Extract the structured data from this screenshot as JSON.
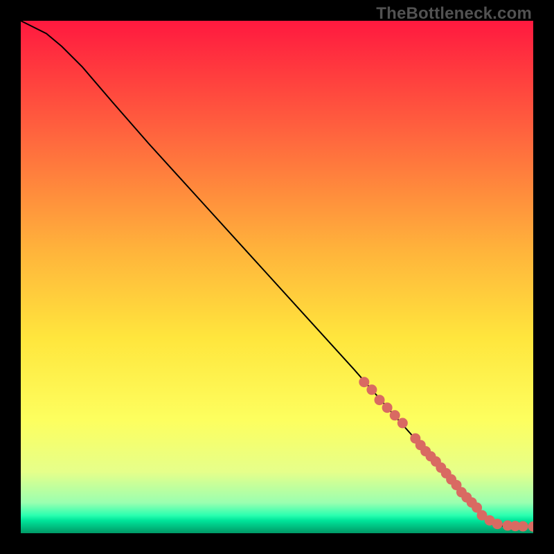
{
  "watermark": "TheBottleneck.com",
  "colors": {
    "gradient_stops": [
      {
        "offset": 0.0,
        "color": "#ff193f"
      },
      {
        "offset": 0.2,
        "color": "#ff5d3e"
      },
      {
        "offset": 0.45,
        "color": "#ffb43b"
      },
      {
        "offset": 0.62,
        "color": "#ffe63d"
      },
      {
        "offset": 0.78,
        "color": "#fdff5f"
      },
      {
        "offset": 0.88,
        "color": "#e6ff8a"
      },
      {
        "offset": 0.94,
        "color": "#9bffb0"
      },
      {
        "offset": 0.965,
        "color": "#2bffb0"
      },
      {
        "offset": 0.975,
        "color": "#00e59a"
      },
      {
        "offset": 1.0,
        "color": "#009966"
      }
    ],
    "curve": "#000000",
    "marker_fill": "#d96a62",
    "marker_stroke": "#d96a62"
  },
  "chart_data": {
    "type": "line",
    "title": "",
    "xlabel": "",
    "ylabel": "",
    "xlim": [
      0,
      100
    ],
    "ylim": [
      0,
      100
    ],
    "series": [
      {
        "name": "bottleneck-curve",
        "x": [
          0,
          2,
          5,
          8,
          12,
          18,
          25,
          35,
          45,
          55,
          65,
          72,
          80,
          86,
          90,
          92,
          94,
          96,
          98,
          100
        ],
        "y": [
          100,
          99,
          97.5,
          95,
          91,
          84,
          76,
          65,
          54,
          43,
          32,
          24,
          15,
          8,
          3.5,
          2,
          1.4,
          1.3,
          1.3,
          1.3
        ]
      }
    ],
    "markers": {
      "name": "highlighted-points",
      "x": [
        67,
        68.5,
        70,
        71.5,
        73,
        74.5,
        77,
        78,
        79,
        80,
        81,
        82,
        83,
        84,
        85,
        86,
        87,
        88,
        89,
        90,
        91.5,
        93,
        95,
        96.5,
        98,
        100
      ],
      "y": [
        29.5,
        28,
        26,
        24.5,
        23,
        21.5,
        18.5,
        17.2,
        16,
        15,
        14,
        12.8,
        11.7,
        10.5,
        9.4,
        8,
        7,
        6,
        5,
        3.5,
        2.5,
        1.8,
        1.5,
        1.4,
        1.35,
        1.3
      ]
    }
  }
}
